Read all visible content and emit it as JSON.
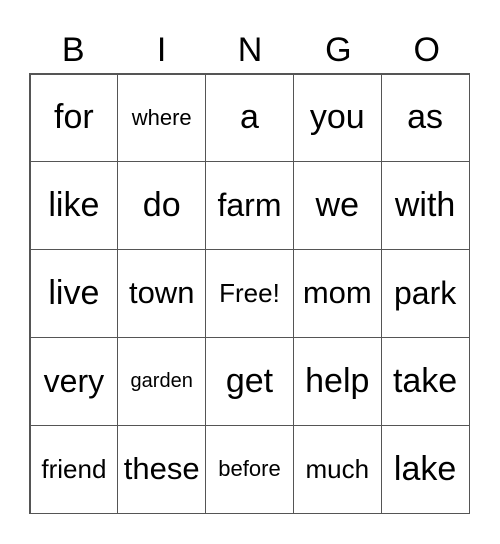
{
  "header": [
    "B",
    "I",
    "N",
    "G",
    "O"
  ],
  "rows": [
    [
      "for",
      "where",
      "a",
      "you",
      "as"
    ],
    [
      "like",
      "do",
      "farm",
      "we",
      "with"
    ],
    [
      "live",
      "town",
      "Free!",
      "mom",
      "park"
    ],
    [
      "very",
      "garden",
      "get",
      "help",
      "take"
    ],
    [
      "friend",
      "these",
      "before",
      "much",
      "lake"
    ]
  ]
}
